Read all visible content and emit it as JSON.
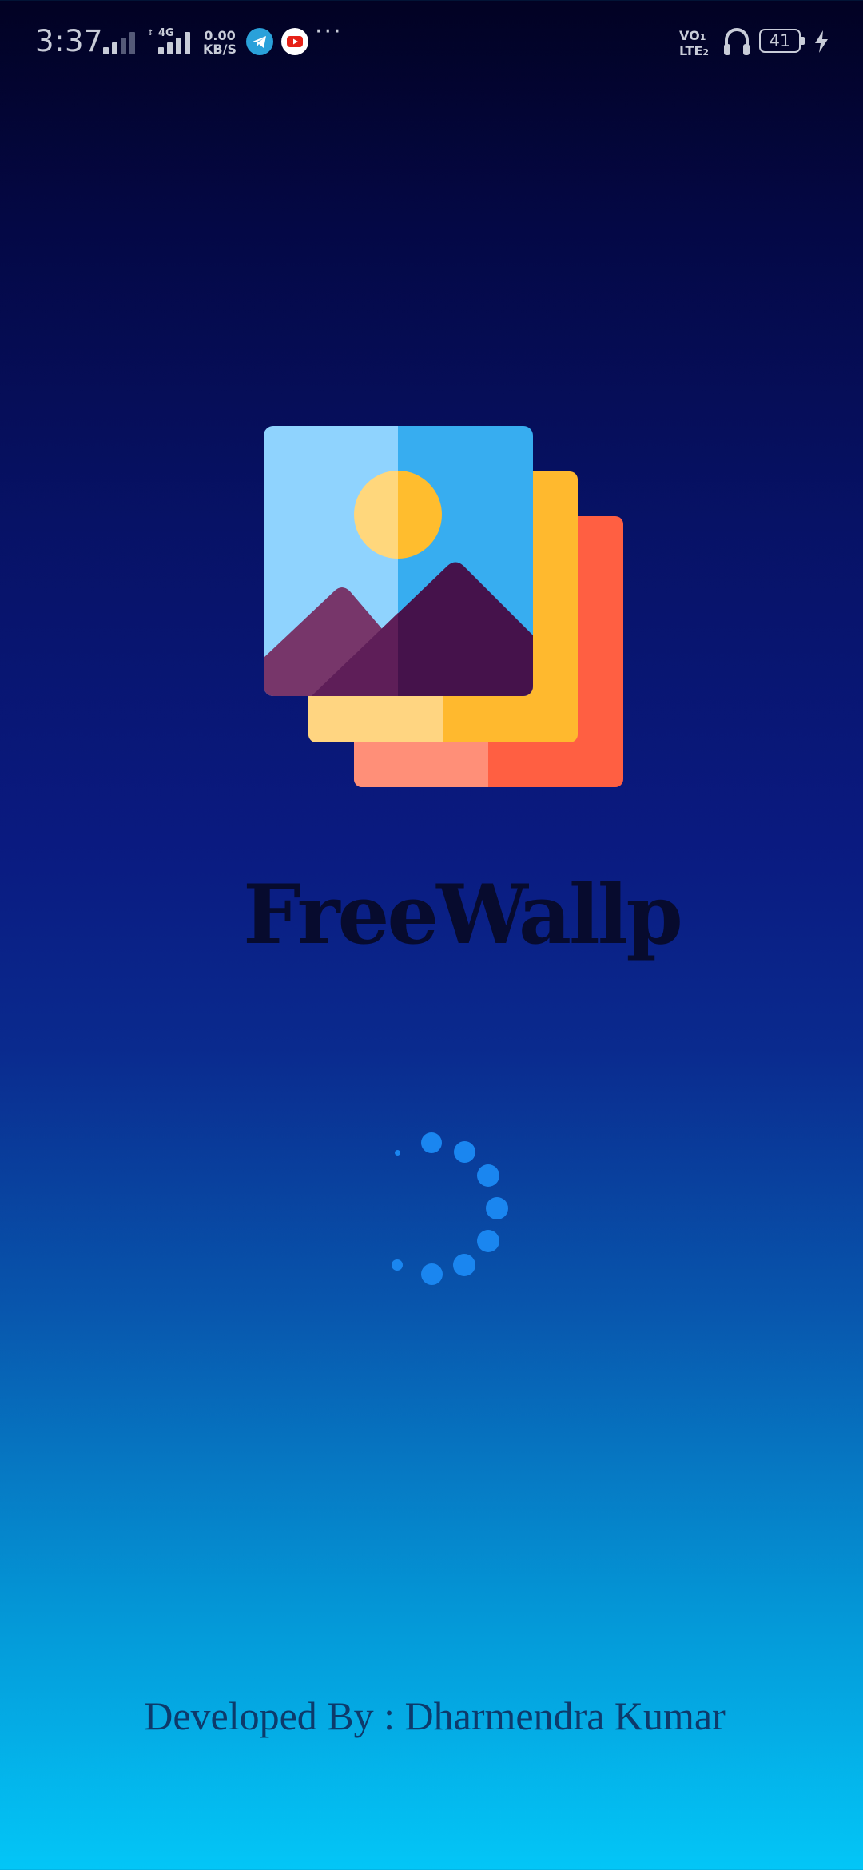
{
  "status_bar": {
    "time": "3:37",
    "network_type": "4G",
    "data_speed_value": "0.00",
    "data_speed_unit": "KB/S",
    "apps": [
      "telegram-icon",
      "youtube-icon"
    ],
    "more": "···",
    "volte_line1": "VO",
    "volte_line2": "LTE",
    "sim1": "1",
    "sim2": "2",
    "battery_level": "41",
    "charging": true
  },
  "splash": {
    "app_name": "FreeWallp",
    "loading": true,
    "developer_credit": "Developed By : Dharmendra Kumar"
  },
  "colors": {
    "frame_back_light": "#ff8f78",
    "frame_back_dark": "#ff5f42",
    "frame_mid_light": "#ffd581",
    "frame_mid_dark": "#ffb92e",
    "sky_light": "#8fd3fe",
    "sky_dark": "#37adf0",
    "sun_light": "#ffd77c",
    "sun_dark": "#ffbd2e",
    "mountain_light": "#77366a",
    "mountain_dark": "#45124b",
    "loader_dot": "#1a86f0",
    "title": "#070b2e",
    "credit": "#0d3a6b"
  }
}
